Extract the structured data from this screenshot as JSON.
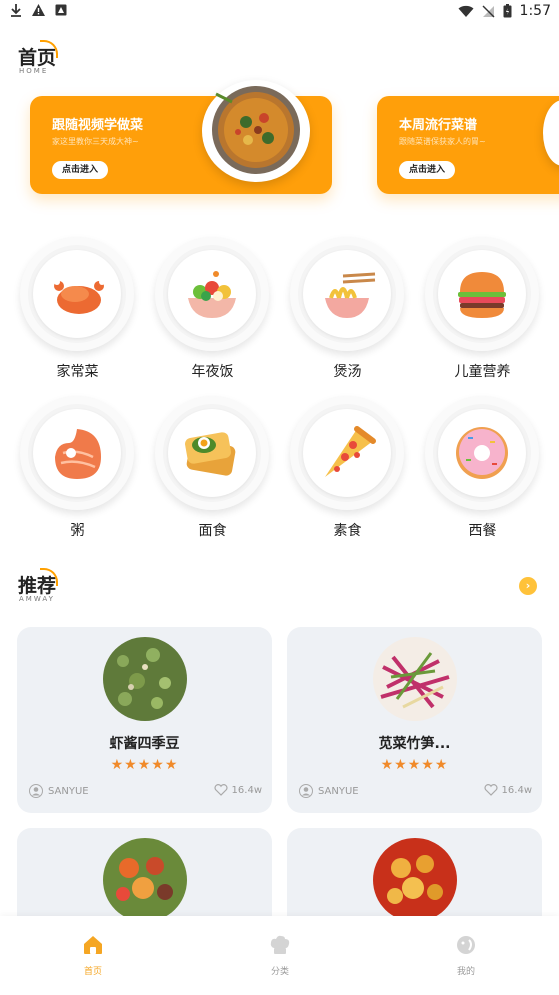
{
  "status_bar": {
    "time": "1:57"
  },
  "home": {
    "title": "首页",
    "subtitle": "HOME"
  },
  "banners": [
    {
      "title": "跟随视频学做菜",
      "subtitle": "家这里教你三天成大神~",
      "button": "点击进入"
    },
    {
      "title": "本周流行菜谱",
      "subtitle": "跟随菜谱保获家人的胃~",
      "button": "点击进入"
    }
  ],
  "categories": [
    {
      "label": "家常菜",
      "icon": "roast-chicken-icon"
    },
    {
      "label": "年夜饭",
      "icon": "salad-bowl-icon"
    },
    {
      "label": "煲汤",
      "icon": "noodle-bowl-icon"
    },
    {
      "label": "儿童营养",
      "icon": "burger-icon"
    },
    {
      "label": "粥",
      "icon": "salmon-steak-icon"
    },
    {
      "label": "面食",
      "icon": "toast-egg-icon"
    },
    {
      "label": "素食",
      "icon": "pizza-slice-icon"
    },
    {
      "label": "西餐",
      "icon": "donut-icon"
    }
  ],
  "recommend": {
    "title": "推荐",
    "subtitle": "AMWAY",
    "more_icon": "chevron-right-icon"
  },
  "recipes": [
    {
      "title": "虾酱四季豆",
      "rating": 4.5,
      "stars": "★★★★★",
      "author": "SANYUE",
      "likes": "16.4w"
    },
    {
      "title": "苋菜竹笋...",
      "rating": 4.5,
      "stars": "★★★★★",
      "author": "SANYUE",
      "likes": "16.4w"
    },
    {
      "title": "",
      "author": "",
      "likes": ""
    },
    {
      "title": "",
      "author": "",
      "likes": ""
    }
  ],
  "bottom_nav": [
    {
      "label": "首页",
      "icon": "home-icon",
      "active": true
    },
    {
      "label": "分类",
      "icon": "chef-hat-icon",
      "active": false
    },
    {
      "label": "我的",
      "icon": "profile-icon",
      "active": false
    }
  ],
  "colors": {
    "accent": "#ff9f0a",
    "star": "#f08a2a",
    "card_bg": "#eef1f5"
  }
}
